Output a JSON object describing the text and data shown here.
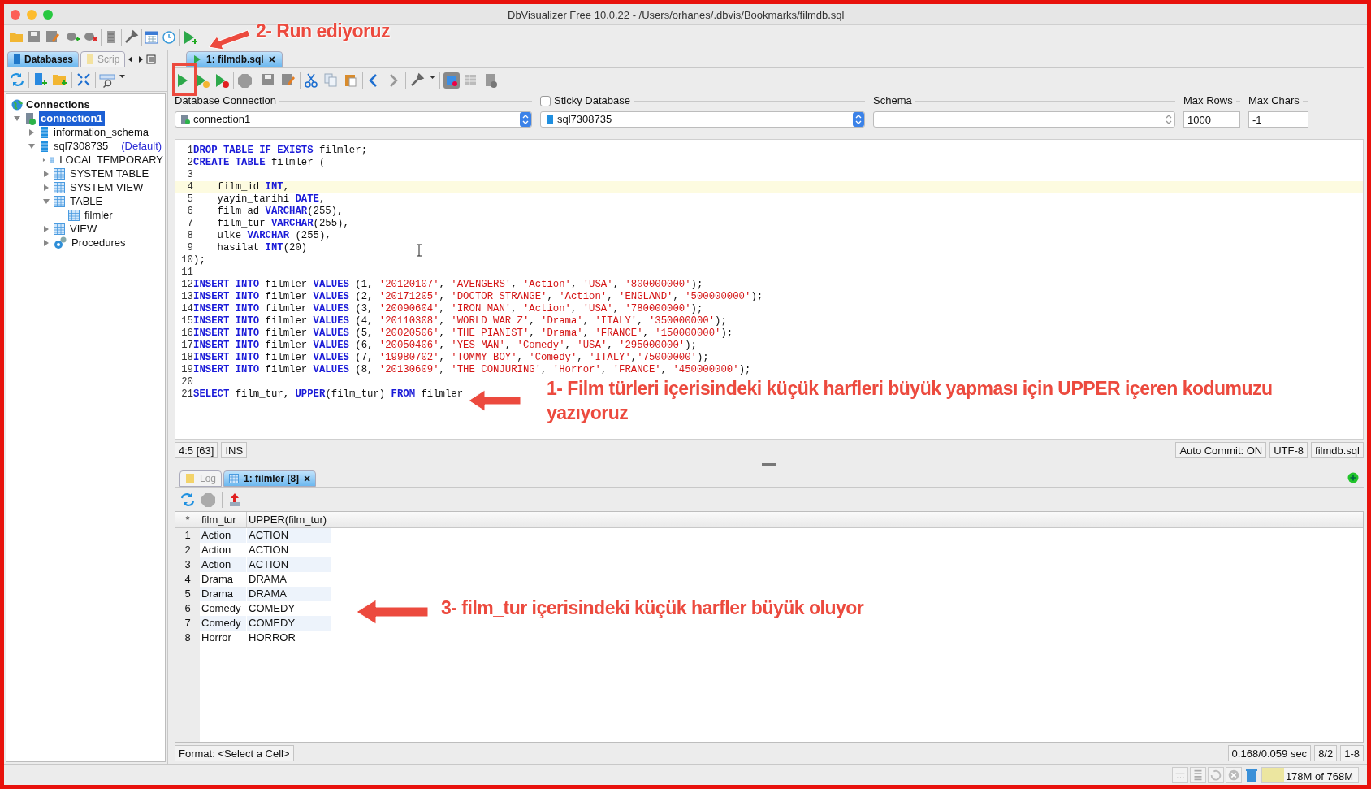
{
  "window": {
    "title": "DbVisualizer Free 10.0.22 - /Users/orhanes/.dbvis/Bookmarks/filmdb.sql"
  },
  "sidebar": {
    "tabs": [
      {
        "label": "Databases",
        "selected": true
      },
      {
        "label": "Scrip",
        "selected": false
      }
    ],
    "tree": {
      "label": "Connections",
      "children": [
        {
          "label": "connection1",
          "kind": "connection",
          "expanded": true,
          "selected": true,
          "children": [
            {
              "label": "information_schema",
              "kind": "schema",
              "expanded": false,
              "selected": false
            },
            {
              "label": "sql7308735",
              "badge": "(Default)",
              "kind": "schema",
              "expanded": true,
              "selected": false,
              "children": [
                {
                  "label": "LOCAL TEMPORARY",
                  "kind": "table",
                  "expanded": false,
                  "selected": false
                },
                {
                  "label": "SYSTEM TABLE",
                  "kind": "table",
                  "expanded": false,
                  "selected": false
                },
                {
                  "label": "SYSTEM VIEW",
                  "kind": "table",
                  "expanded": false,
                  "selected": false
                },
                {
                  "label": "TABLE",
                  "kind": "table",
                  "expanded": true,
                  "selected": false,
                  "children": [
                    {
                      "label": "filmler",
                      "kind": "table",
                      "selected": false
                    }
                  ]
                },
                {
                  "label": "VIEW",
                  "kind": "table",
                  "expanded": false,
                  "selected": false
                },
                {
                  "label": "Procedures",
                  "kind": "procedures",
                  "expanded": false,
                  "selected": false
                }
              ]
            }
          ]
        }
      ]
    }
  },
  "editor": {
    "tabs": [
      {
        "label": "1: filmdb.sql",
        "close": "×",
        "selected": true
      }
    ],
    "fields": {
      "connection_label": "Database Connection",
      "connection": "connection1",
      "sticky_label": "Sticky Database",
      "sticky": false,
      "database": "sql7308735",
      "schema_label": "Schema",
      "max_rows_label": "Max Rows",
      "max_rows": "1000",
      "max_chars_label": "Max Chars",
      "max_chars": "-1"
    },
    "lines": [
      {
        "number": "1",
        "current": false,
        "tokens": [
          {
            "kind": "kw",
            "text": "DROP TABLE IF EXISTS"
          },
          {
            "kind": "plain",
            "text": " filmler;"
          }
        ]
      },
      {
        "number": "2",
        "current": false,
        "tokens": [
          {
            "kind": "kw",
            "text": "CREATE TABLE"
          },
          {
            "kind": "plain",
            "text": " filmler ("
          }
        ]
      },
      {
        "number": "3",
        "current": false
      },
      {
        "number": "4",
        "current": true,
        "tokens": [
          {
            "kind": "plain",
            "text": "    film_id "
          },
          {
            "kind": "kw",
            "text": "INT"
          },
          {
            "kind": "plain",
            "text": ","
          }
        ]
      },
      {
        "number": "5",
        "current": false,
        "tokens": [
          {
            "kind": "plain",
            "text": "    yayin_tarihi "
          },
          {
            "kind": "kw",
            "text": "DATE"
          },
          {
            "kind": "plain",
            "text": ","
          }
        ]
      },
      {
        "number": "6",
        "current": false,
        "tokens": [
          {
            "kind": "plain",
            "text": "    film_ad "
          },
          {
            "kind": "kw",
            "text": "VARCHAR"
          },
          {
            "kind": "plain",
            "text": "(255),"
          }
        ]
      },
      {
        "number": "7",
        "current": false,
        "tokens": [
          {
            "kind": "plain",
            "text": "    film_tur "
          },
          {
            "kind": "kw",
            "text": "VARCHAR"
          },
          {
            "kind": "plain",
            "text": "(255),"
          }
        ]
      },
      {
        "number": "8",
        "current": false,
        "tokens": [
          {
            "kind": "plain",
            "text": "    ulke "
          },
          {
            "kind": "kw",
            "text": "VARCHAR"
          },
          {
            "kind": "plain",
            "text": " (255),"
          }
        ]
      },
      {
        "number": "9",
        "current": false,
        "tokens": [
          {
            "kind": "plain",
            "text": "    hasilat "
          },
          {
            "kind": "kw",
            "text": "INT"
          },
          {
            "kind": "plain",
            "text": "(20)"
          }
        ]
      },
      {
        "number": "10",
        "current": false,
        "tokens": [
          {
            "kind": "plain",
            "text": ");"
          }
        ]
      },
      {
        "number": "11",
        "current": false
      },
      {
        "number": "12",
        "current": false,
        "tokens": [
          {
            "kind": "kw",
            "text": "INSERT INTO"
          },
          {
            "kind": "plain",
            "text": " filmler "
          },
          {
            "kind": "kw",
            "text": "VALUES"
          },
          {
            "kind": "plain",
            "text": " (1, "
          },
          {
            "kind": "str",
            "text": "'20120107'"
          },
          {
            "kind": "plain",
            "text": ", "
          },
          {
            "kind": "str",
            "text": "'AVENGERS'"
          },
          {
            "kind": "plain",
            "text": ", "
          },
          {
            "kind": "str",
            "text": "'Action'"
          },
          {
            "kind": "plain",
            "text": ", "
          },
          {
            "kind": "str",
            "text": "'USA'"
          },
          {
            "kind": "plain",
            "text": ", "
          },
          {
            "kind": "str",
            "text": "'800000000'"
          },
          {
            "kind": "plain",
            "text": ");"
          }
        ]
      },
      {
        "number": "13",
        "current": false,
        "tokens": [
          {
            "kind": "kw",
            "text": "INSERT INTO"
          },
          {
            "kind": "plain",
            "text": " filmler "
          },
          {
            "kind": "kw",
            "text": "VALUES"
          },
          {
            "kind": "plain",
            "text": " (2, "
          },
          {
            "kind": "str",
            "text": "'20171205'"
          },
          {
            "kind": "plain",
            "text": ", "
          },
          {
            "kind": "str",
            "text": "'DOCTOR STRANGE'"
          },
          {
            "kind": "plain",
            "text": ", "
          },
          {
            "kind": "str",
            "text": "'Action'"
          },
          {
            "kind": "plain",
            "text": ", "
          },
          {
            "kind": "str",
            "text": "'ENGLAND'"
          },
          {
            "kind": "plain",
            "text": ", "
          },
          {
            "kind": "str",
            "text": "'500000000'"
          },
          {
            "kind": "plain",
            "text": ");"
          }
        ]
      },
      {
        "number": "14",
        "current": false,
        "tokens": [
          {
            "kind": "kw",
            "text": "INSERT INTO"
          },
          {
            "kind": "plain",
            "text": " filmler "
          },
          {
            "kind": "kw",
            "text": "VALUES"
          },
          {
            "kind": "plain",
            "text": " (3, "
          },
          {
            "kind": "str",
            "text": "'20090604'"
          },
          {
            "kind": "plain",
            "text": ", "
          },
          {
            "kind": "str",
            "text": "'IRON MAN'"
          },
          {
            "kind": "plain",
            "text": ", "
          },
          {
            "kind": "str",
            "text": "'Action'"
          },
          {
            "kind": "plain",
            "text": ", "
          },
          {
            "kind": "str",
            "text": "'USA'"
          },
          {
            "kind": "plain",
            "text": ", "
          },
          {
            "kind": "str",
            "text": "'780000000'"
          },
          {
            "kind": "plain",
            "text": ");"
          }
        ]
      },
      {
        "number": "15",
        "current": false,
        "tokens": [
          {
            "kind": "kw",
            "text": "INSERT INTO"
          },
          {
            "kind": "plain",
            "text": " filmler "
          },
          {
            "kind": "kw",
            "text": "VALUES"
          },
          {
            "kind": "plain",
            "text": " (4, "
          },
          {
            "kind": "str",
            "text": "'20110308'"
          },
          {
            "kind": "plain",
            "text": ", "
          },
          {
            "kind": "str",
            "text": "'WORLD WAR Z'"
          },
          {
            "kind": "plain",
            "text": ", "
          },
          {
            "kind": "str",
            "text": "'Drama'"
          },
          {
            "kind": "plain",
            "text": ", "
          },
          {
            "kind": "str",
            "text": "'ITALY'"
          },
          {
            "kind": "plain",
            "text": ", "
          },
          {
            "kind": "str",
            "text": "'350000000'"
          },
          {
            "kind": "plain",
            "text": ");"
          }
        ]
      },
      {
        "number": "16",
        "current": false,
        "tokens": [
          {
            "kind": "kw",
            "text": "INSERT INTO"
          },
          {
            "kind": "plain",
            "text": " filmler "
          },
          {
            "kind": "kw",
            "text": "VALUES"
          },
          {
            "kind": "plain",
            "text": " (5, "
          },
          {
            "kind": "str",
            "text": "'20020506'"
          },
          {
            "kind": "plain",
            "text": ", "
          },
          {
            "kind": "str",
            "text": "'THE PIANIST'"
          },
          {
            "kind": "plain",
            "text": ", "
          },
          {
            "kind": "str",
            "text": "'Drama'"
          },
          {
            "kind": "plain",
            "text": ", "
          },
          {
            "kind": "str",
            "text": "'FRANCE'"
          },
          {
            "kind": "plain",
            "text": ", "
          },
          {
            "kind": "str",
            "text": "'150000000'"
          },
          {
            "kind": "plain",
            "text": ");"
          }
        ]
      },
      {
        "number": "17",
        "current": false,
        "tokens": [
          {
            "kind": "kw",
            "text": "INSERT INTO"
          },
          {
            "kind": "plain",
            "text": " filmler "
          },
          {
            "kind": "kw",
            "text": "VALUES"
          },
          {
            "kind": "plain",
            "text": " (6, "
          },
          {
            "kind": "str",
            "text": "'20050406'"
          },
          {
            "kind": "plain",
            "text": ", "
          },
          {
            "kind": "str",
            "text": "'YES MAN'"
          },
          {
            "kind": "plain",
            "text": ", "
          },
          {
            "kind": "str",
            "text": "'Comedy'"
          },
          {
            "kind": "plain",
            "text": ", "
          },
          {
            "kind": "str",
            "text": "'USA'"
          },
          {
            "kind": "plain",
            "text": ", "
          },
          {
            "kind": "str",
            "text": "'295000000'"
          },
          {
            "kind": "plain",
            "text": ");"
          }
        ]
      },
      {
        "number": "18",
        "current": false,
        "tokens": [
          {
            "kind": "kw",
            "text": "INSERT INTO"
          },
          {
            "kind": "plain",
            "text": " filmler "
          },
          {
            "kind": "kw",
            "text": "VALUES"
          },
          {
            "kind": "plain",
            "text": " (7, "
          },
          {
            "kind": "str",
            "text": "'19980702'"
          },
          {
            "kind": "plain",
            "text": ", "
          },
          {
            "kind": "str",
            "text": "'TOMMY BOY'"
          },
          {
            "kind": "plain",
            "text": ", "
          },
          {
            "kind": "str",
            "text": "'Comedy'"
          },
          {
            "kind": "plain",
            "text": ", "
          },
          {
            "kind": "str",
            "text": "'ITALY'"
          },
          {
            "kind": "plain",
            "text": ","
          },
          {
            "kind": "str",
            "text": "'75000000'"
          },
          {
            "kind": "plain",
            "text": ");"
          }
        ]
      },
      {
        "number": "19",
        "current": false,
        "tokens": [
          {
            "kind": "kw",
            "text": "INSERT INTO"
          },
          {
            "kind": "plain",
            "text": " filmler "
          },
          {
            "kind": "kw",
            "text": "VALUES"
          },
          {
            "kind": "plain",
            "text": " (8, "
          },
          {
            "kind": "str",
            "text": "'20130609'"
          },
          {
            "kind": "plain",
            "text": ", "
          },
          {
            "kind": "str",
            "text": "'THE CONJURING'"
          },
          {
            "kind": "plain",
            "text": ", "
          },
          {
            "kind": "str",
            "text": "'Horror'"
          },
          {
            "kind": "plain",
            "text": ", "
          },
          {
            "kind": "str",
            "text": "'FRANCE'"
          },
          {
            "kind": "plain",
            "text": ", "
          },
          {
            "kind": "str",
            "text": "'450000000'"
          },
          {
            "kind": "plain",
            "text": ");"
          }
        ]
      },
      {
        "number": "20",
        "current": false
      },
      {
        "number": "21",
        "current": false,
        "tokens": [
          {
            "kind": "kw",
            "text": "SELECT"
          },
          {
            "kind": "plain",
            "text": " film_tur, "
          },
          {
            "kind": "kw",
            "text": "UPPER"
          },
          {
            "kind": "plain",
            "text": "(film_tur) "
          },
          {
            "kind": "kw",
            "text": "FROM"
          },
          {
            "kind": "plain",
            "text": " filmler"
          }
        ]
      }
    ],
    "status_left": [
      "4:5 [63]",
      "INS"
    ],
    "status_right": [
      "Auto Commit: ON",
      "UTF-8",
      "filmdb.sql"
    ]
  },
  "results": {
    "tabs": [
      {
        "label": "Log",
        "selected": false
      },
      {
        "label": "1: filmler [8]",
        "close": "×",
        "selected": true
      }
    ],
    "columns": [
      "*",
      "film_tur",
      "UPPER(film_tur)"
    ],
    "rows": [
      [
        "1",
        "Action",
        "ACTION"
      ],
      [
        "2",
        "Action",
        "ACTION"
      ],
      [
        "3",
        "Action",
        "ACTION"
      ],
      [
        "4",
        "Drama",
        "DRAMA"
      ],
      [
        "5",
        "Drama",
        "DRAMA"
      ],
      [
        "6",
        "Comedy",
        "COMEDY"
      ],
      [
        "7",
        "Comedy",
        "COMEDY"
      ],
      [
        "8",
        "Horror",
        "HORROR"
      ]
    ],
    "format": "Format: <Select a Cell>",
    "status_right": [
      "0.168/0.059 sec",
      "8/2",
      "1-8"
    ]
  },
  "status_bar": {
    "memory": {
      "text": "178M of 768M",
      "level": 0.23
    }
  },
  "annotations": [
    {
      "kind": "editor",
      "text": "1- Film türleri içerisindeki küçük harfleri büyük yapması için UPPER içeren kodumuzu yazıyoruz"
    },
    {
      "kind": "run",
      "text": "2- Run ediyoruz"
    },
    {
      "kind": "results",
      "text": "3- film_tur içerisindeki küçük harfler büyük oluyor"
    }
  ]
}
